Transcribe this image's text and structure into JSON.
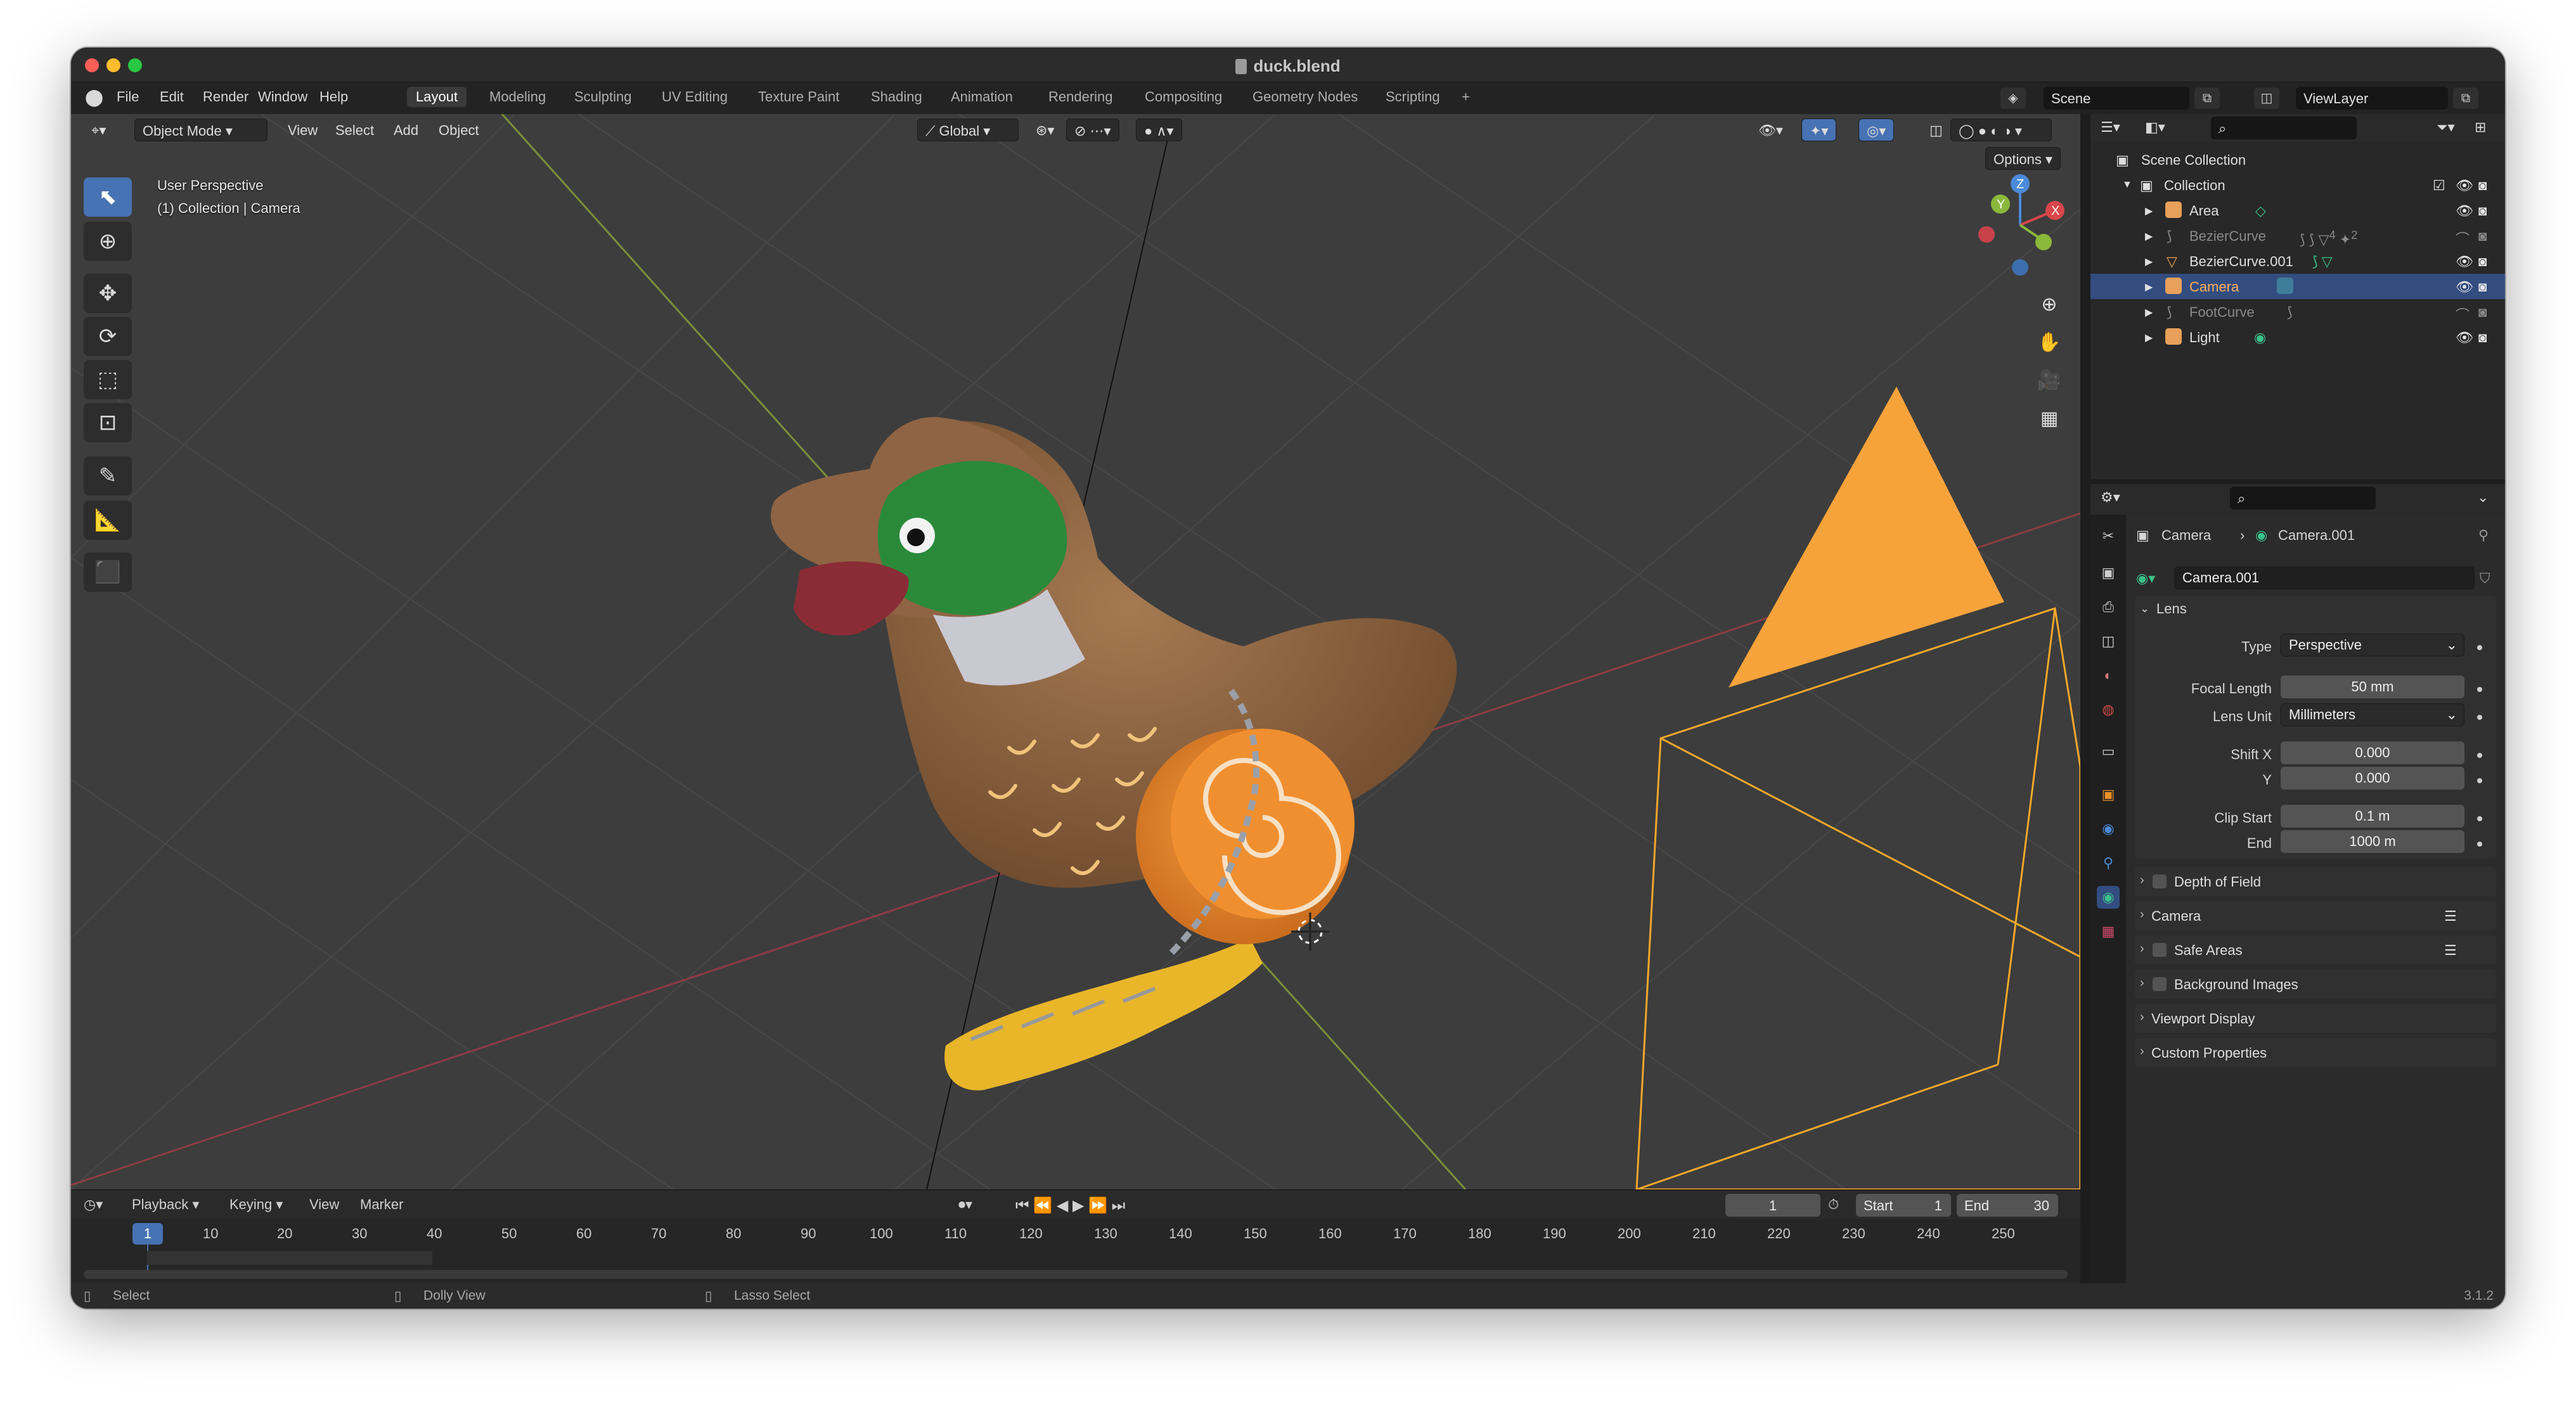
{
  "window": {
    "title": "duck.blend"
  },
  "menu": {
    "items": [
      "File",
      "Edit",
      "Render",
      "Window",
      "Help"
    ]
  },
  "workspaces": [
    "Layout",
    "Modeling",
    "Sculpting",
    "UV Editing",
    "Texture Paint",
    "Shading",
    "Animation",
    "Rendering",
    "Compositing",
    "Geometry Nodes",
    "Scripting",
    "+"
  ],
  "scene": {
    "name": "Scene",
    "view_layer": "ViewLayer"
  },
  "viewport": {
    "mode": "Object Mode",
    "menus": [
      "View",
      "Select",
      "Add",
      "Object"
    ],
    "orientation": "Global",
    "options_label": "Options",
    "overlay_line1": "User Perspective",
    "overlay_line2": "(1) Collection | Camera",
    "gizmo_axes": [
      "X",
      "Y",
      "Z"
    ],
    "icons": [
      "select-box-icon",
      "cursor-icon",
      "move-icon",
      "rotate-icon",
      "scale-icon",
      "transform-icon",
      "annotate-icon",
      "measure-icon",
      "add-cube-icon"
    ]
  },
  "timeline": {
    "menus": [
      "Playback",
      "Keying",
      "View",
      "Marker"
    ],
    "current_frame": "1",
    "start_label": "Start",
    "start_value": "1",
    "end_label": "End",
    "end_value": "30",
    "ruler": [
      "10",
      "20",
      "30",
      "40",
      "50",
      "60",
      "70",
      "80",
      "90",
      "100",
      "110",
      "120",
      "130",
      "140",
      "150",
      "160",
      "170",
      "180",
      "190",
      "200",
      "210",
      "220",
      "230",
      "240",
      "250"
    ],
    "badge": "1"
  },
  "statusbar": {
    "select": "Select",
    "dolly": "Dolly View",
    "lasso": "Lasso Select",
    "version": "3.1.2"
  },
  "outliner": {
    "scene_collection": "Scene Collection",
    "collection": "Collection",
    "items": [
      {
        "name": "Area",
        "dim": false,
        "selected": false,
        "icon_color": "#e8a05a"
      },
      {
        "name": "BezierCurve",
        "dim": true,
        "selected": false,
        "icon_color": "#e8a05a"
      },
      {
        "name": "BezierCurve.001",
        "dim": false,
        "selected": false,
        "icon_color": "#e8a05a"
      },
      {
        "name": "Camera",
        "dim": false,
        "selected": true,
        "icon_color": "#e8a05a"
      },
      {
        "name": "FootCurve",
        "dim": true,
        "selected": false,
        "icon_color": "#e8a05a"
      },
      {
        "name": "Light",
        "dim": false,
        "selected": false,
        "icon_color": "#e8a05a"
      }
    ],
    "extras": [
      "4",
      "2"
    ]
  },
  "properties": {
    "breadcrumb_obj": "Camera",
    "breadcrumb_data": "Camera.001",
    "datablock": "Camera.001",
    "lens_title": "Lens",
    "type_label": "Type",
    "type_value": "Perspective",
    "focal_label": "Focal Length",
    "focal_value": "50 mm",
    "lens_unit_label": "Lens Unit",
    "lens_unit_value": "Millimeters",
    "shift_x_label": "Shift X",
    "shift_x_value": "0.000",
    "shift_y_label": "Y",
    "shift_y_value": "0.000",
    "clip_start_label": "Clip Start",
    "clip_start_value": "0.1 m",
    "clip_end_label": "End",
    "clip_end_value": "1000 m",
    "panels": [
      "Depth of Field",
      "Camera",
      "Safe Areas",
      "Background Images",
      "Viewport Display",
      "Custom Properties"
    ]
  },
  "colors": {
    "accent": "#4772b3",
    "selection": "#334d80",
    "camera_frame": "#f2a72c",
    "light_triangle": "#f5a33a",
    "viewport_bg": "#3d3d3d"
  }
}
